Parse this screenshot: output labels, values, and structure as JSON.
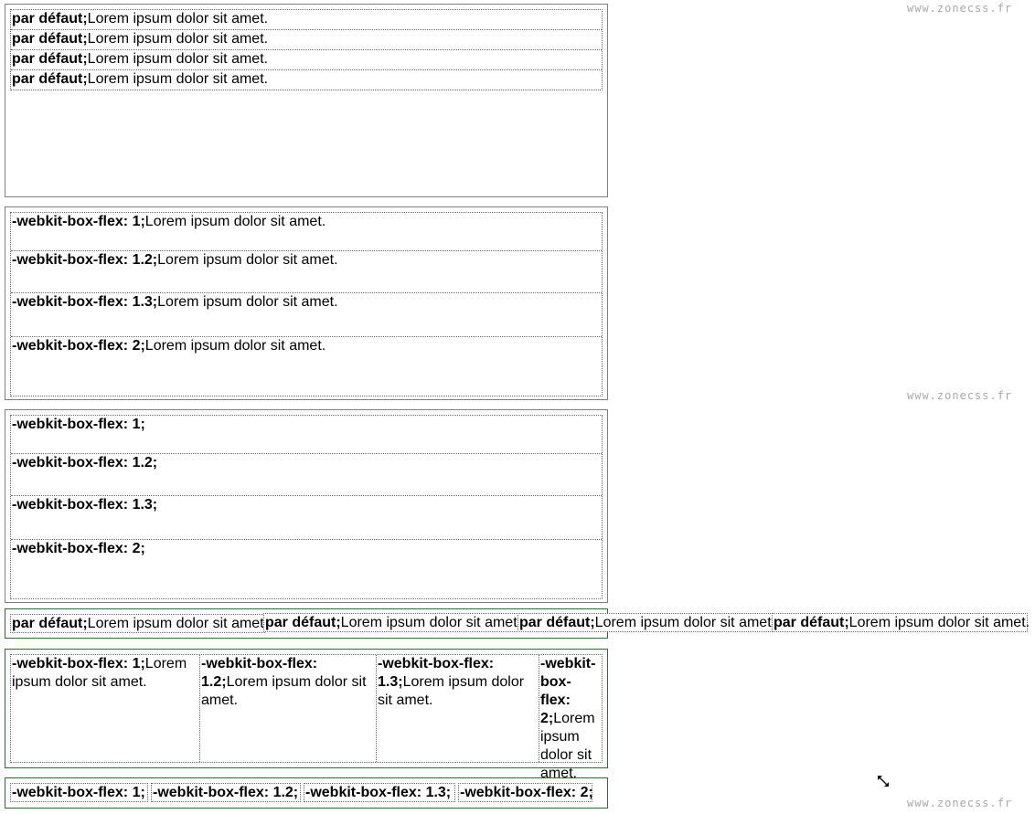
{
  "watermark": "www.zonecss.fr",
  "default_label": "par défaut;",
  "lorem": "Lorem ipsum dolor sit amet.",
  "flex_labels": [
    "-webkit-box-flex: 1;",
    "-webkit-box-flex: 1.2;",
    "-webkit-box-flex: 1.3;",
    "-webkit-box-flex: 2;"
  ],
  "column_labels": {
    "c2_a": "-webkit-box-flex:",
    "c2_b": "1.2;",
    "c3_a": "-webkit-box-flex:",
    "c3_b": "1.3;",
    "c4_a": "-webkit-",
    "c4_b": "box-flex:",
    "c4_c": "2;",
    "c4_lorem": [
      "Lorem",
      "ipsum",
      "dolor sit",
      "amet."
    ]
  }
}
